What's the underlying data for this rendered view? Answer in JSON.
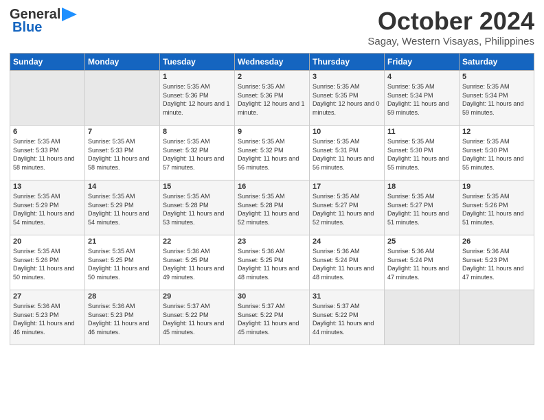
{
  "header": {
    "logo_line1": "General",
    "logo_line2": "Blue",
    "month": "October 2024",
    "location": "Sagay, Western Visayas, Philippines"
  },
  "weekdays": [
    "Sunday",
    "Monday",
    "Tuesday",
    "Wednesday",
    "Thursday",
    "Friday",
    "Saturday"
  ],
  "weeks": [
    [
      {
        "day": "",
        "empty": true
      },
      {
        "day": "",
        "empty": true
      },
      {
        "day": "1",
        "sunrise": "5:35 AM",
        "sunset": "5:36 PM",
        "daylight": "12 hours and 1 minute."
      },
      {
        "day": "2",
        "sunrise": "5:35 AM",
        "sunset": "5:36 PM",
        "daylight": "12 hours and 1 minute."
      },
      {
        "day": "3",
        "sunrise": "5:35 AM",
        "sunset": "5:35 PM",
        "daylight": "12 hours and 0 minutes."
      },
      {
        "day": "4",
        "sunrise": "5:35 AM",
        "sunset": "5:34 PM",
        "daylight": "11 hours and 59 minutes."
      },
      {
        "day": "5",
        "sunrise": "5:35 AM",
        "sunset": "5:34 PM",
        "daylight": "11 hours and 59 minutes."
      }
    ],
    [
      {
        "day": "6",
        "sunrise": "5:35 AM",
        "sunset": "5:33 PM",
        "daylight": "11 hours and 58 minutes."
      },
      {
        "day": "7",
        "sunrise": "5:35 AM",
        "sunset": "5:33 PM",
        "daylight": "11 hours and 58 minutes."
      },
      {
        "day": "8",
        "sunrise": "5:35 AM",
        "sunset": "5:32 PM",
        "daylight": "11 hours and 57 minutes."
      },
      {
        "day": "9",
        "sunrise": "5:35 AM",
        "sunset": "5:32 PM",
        "daylight": "11 hours and 56 minutes."
      },
      {
        "day": "10",
        "sunrise": "5:35 AM",
        "sunset": "5:31 PM",
        "daylight": "11 hours and 56 minutes."
      },
      {
        "day": "11",
        "sunrise": "5:35 AM",
        "sunset": "5:30 PM",
        "daylight": "11 hours and 55 minutes."
      },
      {
        "day": "12",
        "sunrise": "5:35 AM",
        "sunset": "5:30 PM",
        "daylight": "11 hours and 55 minutes."
      }
    ],
    [
      {
        "day": "13",
        "sunrise": "5:35 AM",
        "sunset": "5:29 PM",
        "daylight": "11 hours and 54 minutes."
      },
      {
        "day": "14",
        "sunrise": "5:35 AM",
        "sunset": "5:29 PM",
        "daylight": "11 hours and 54 minutes."
      },
      {
        "day": "15",
        "sunrise": "5:35 AM",
        "sunset": "5:28 PM",
        "daylight": "11 hours and 53 minutes."
      },
      {
        "day": "16",
        "sunrise": "5:35 AM",
        "sunset": "5:28 PM",
        "daylight": "11 hours and 52 minutes."
      },
      {
        "day": "17",
        "sunrise": "5:35 AM",
        "sunset": "5:27 PM",
        "daylight": "11 hours and 52 minutes."
      },
      {
        "day": "18",
        "sunrise": "5:35 AM",
        "sunset": "5:27 PM",
        "daylight": "11 hours and 51 minutes."
      },
      {
        "day": "19",
        "sunrise": "5:35 AM",
        "sunset": "5:26 PM",
        "daylight": "11 hours and 51 minutes."
      }
    ],
    [
      {
        "day": "20",
        "sunrise": "5:35 AM",
        "sunset": "5:26 PM",
        "daylight": "11 hours and 50 minutes."
      },
      {
        "day": "21",
        "sunrise": "5:35 AM",
        "sunset": "5:25 PM",
        "daylight": "11 hours and 50 minutes."
      },
      {
        "day": "22",
        "sunrise": "5:36 AM",
        "sunset": "5:25 PM",
        "daylight": "11 hours and 49 minutes."
      },
      {
        "day": "23",
        "sunrise": "5:36 AM",
        "sunset": "5:25 PM",
        "daylight": "11 hours and 48 minutes."
      },
      {
        "day": "24",
        "sunrise": "5:36 AM",
        "sunset": "5:24 PM",
        "daylight": "11 hours and 48 minutes."
      },
      {
        "day": "25",
        "sunrise": "5:36 AM",
        "sunset": "5:24 PM",
        "daylight": "11 hours and 47 minutes."
      },
      {
        "day": "26",
        "sunrise": "5:36 AM",
        "sunset": "5:23 PM",
        "daylight": "11 hours and 47 minutes."
      }
    ],
    [
      {
        "day": "27",
        "sunrise": "5:36 AM",
        "sunset": "5:23 PM",
        "daylight": "11 hours and 46 minutes."
      },
      {
        "day": "28",
        "sunrise": "5:36 AM",
        "sunset": "5:23 PM",
        "daylight": "11 hours and 46 minutes."
      },
      {
        "day": "29",
        "sunrise": "5:37 AM",
        "sunset": "5:22 PM",
        "daylight": "11 hours and 45 minutes."
      },
      {
        "day": "30",
        "sunrise": "5:37 AM",
        "sunset": "5:22 PM",
        "daylight": "11 hours and 45 minutes."
      },
      {
        "day": "31",
        "sunrise": "5:37 AM",
        "sunset": "5:22 PM",
        "daylight": "11 hours and 44 minutes."
      },
      {
        "day": "",
        "empty": true
      },
      {
        "day": "",
        "empty": true
      }
    ]
  ],
  "labels": {
    "sunrise": "Sunrise:",
    "sunset": "Sunset:",
    "daylight": "Daylight:"
  }
}
